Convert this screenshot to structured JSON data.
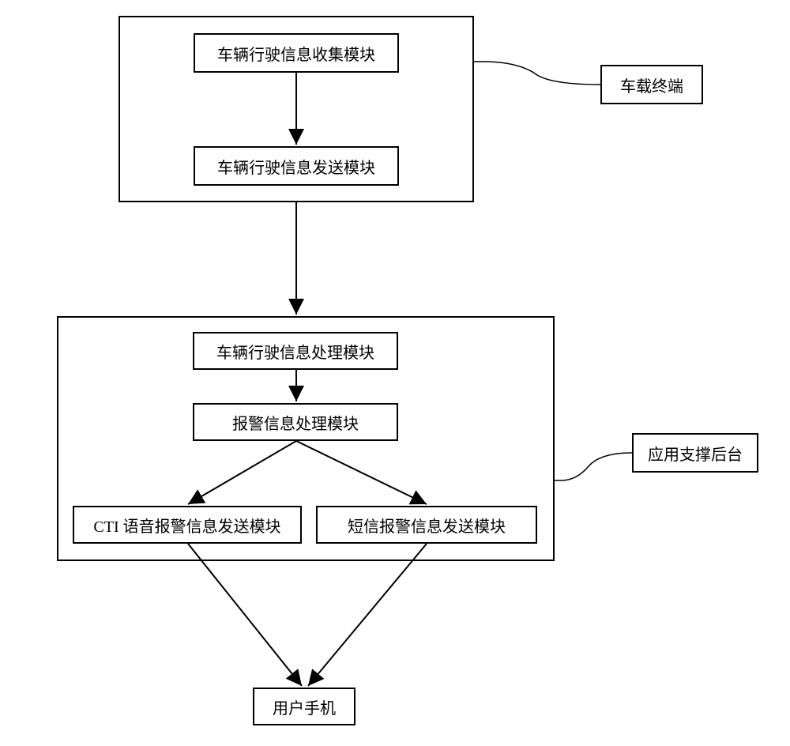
{
  "top_group": {
    "module1": "车辆行驶信息收集模块",
    "module2": "车辆行驶信息发送模块"
  },
  "top_label": "车载终端",
  "mid_group": {
    "module1": "车辆行驶信息处理模块",
    "module2": "报警信息处理模块",
    "module3": "CTI 语音报警信息发送模块",
    "module4": "短信报警信息发送模块"
  },
  "mid_label": "应用支撑后台",
  "bottom": "用户手机"
}
